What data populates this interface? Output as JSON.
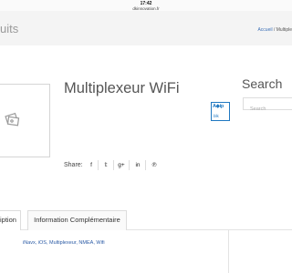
{
  "statusbar": {
    "time": "17:42",
    "url": "dkinnovation.fr"
  },
  "header": {
    "section_title": "uits",
    "breadcrumb": {
      "home": "Accueil",
      "separator": " / ",
      "current": "Multiple"
    }
  },
  "product": {
    "title": "Multiplexeur WiFi",
    "image_icon": "image-placeholder-icon",
    "brand_badge": {
      "top": "A◆ip",
      "bottom": "blk",
      "color": "#1f78c1"
    }
  },
  "search": {
    "title": "Search",
    "placeholder": "Search"
  },
  "share": {
    "label": "Share:",
    "icons": [
      {
        "name": "facebook-icon",
        "glyph": "f"
      },
      {
        "name": "twitter-icon",
        "glyph": "𝕥"
      },
      {
        "name": "google-plus-icon",
        "glyph": "g+"
      },
      {
        "name": "linkedin-icon",
        "glyph": "in"
      },
      {
        "name": "pinterest-icon",
        "glyph": "℗"
      }
    ]
  },
  "tabs": [
    {
      "label": "iption"
    },
    {
      "label": "Information Complémentaire"
    }
  ],
  "description": {
    "tags": "iNavx, iOS, Multiplexeur, NMEA, Wifi"
  },
  "colors": {
    "link": "#3b6fb6",
    "tag": "#2a5aa5",
    "background": "#f2f2f2"
  }
}
